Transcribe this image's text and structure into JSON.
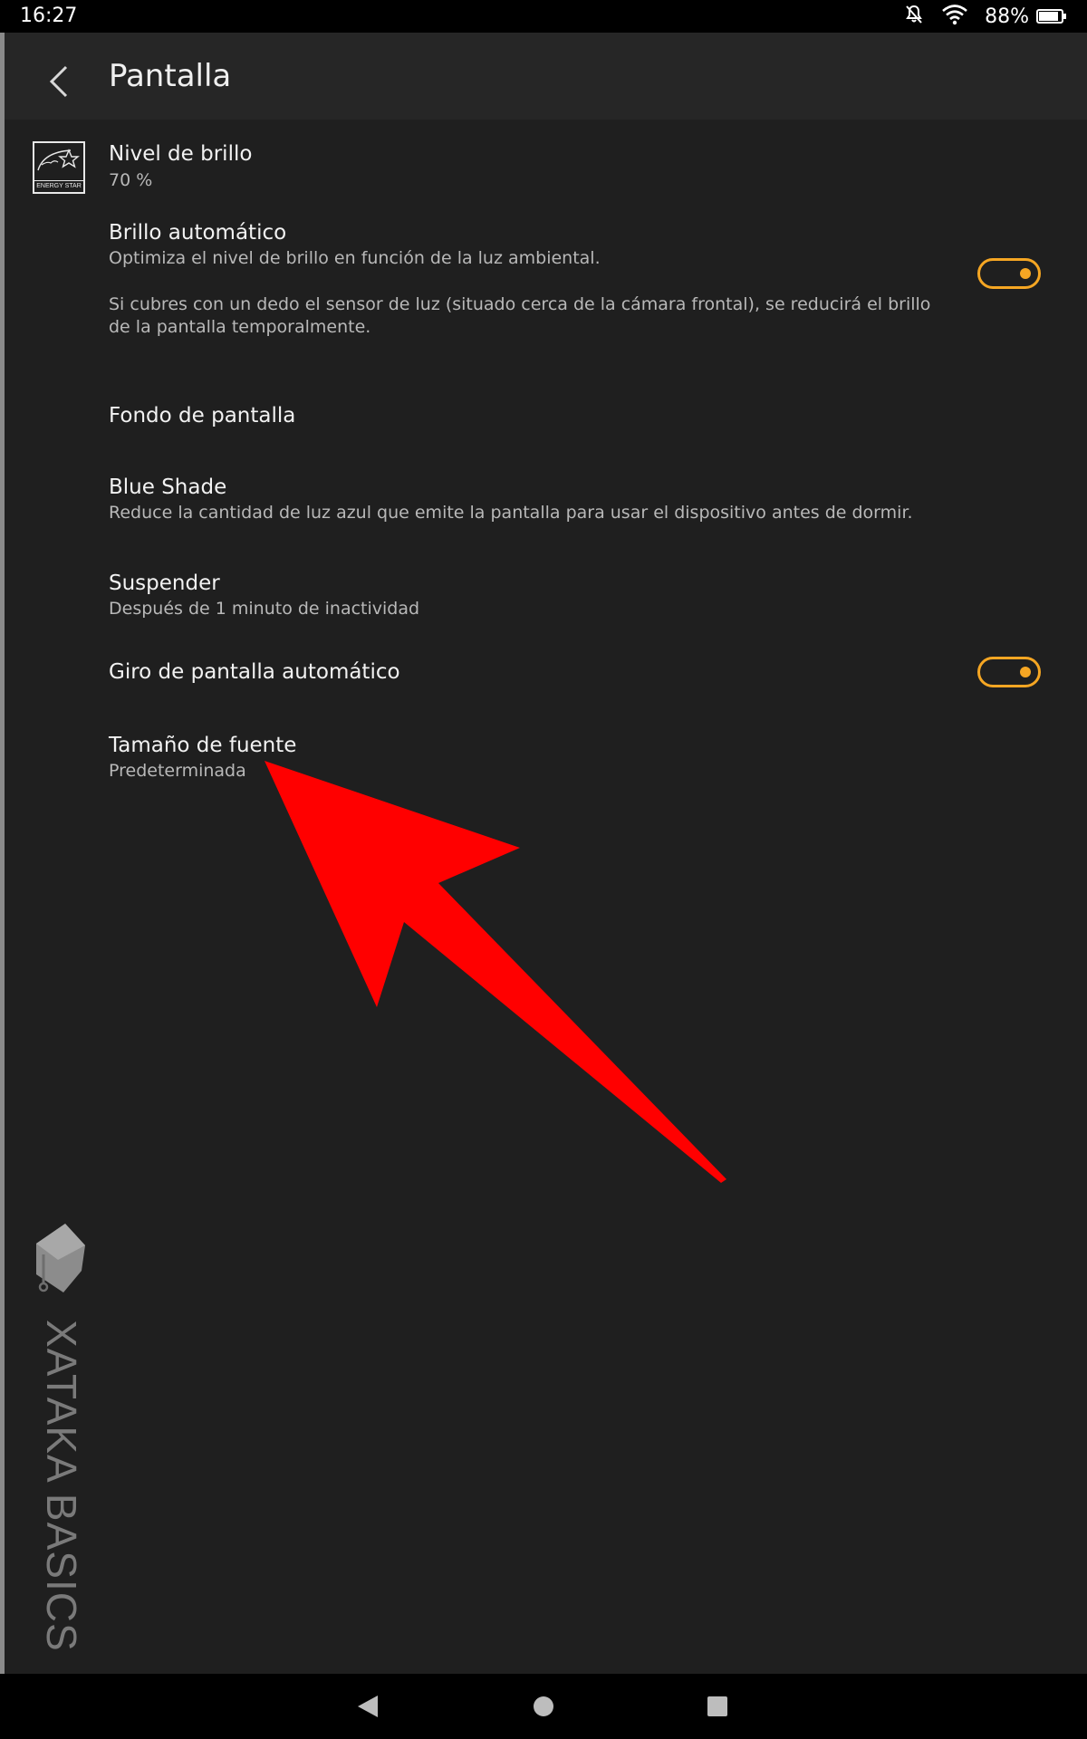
{
  "status_bar": {
    "time": "16:27",
    "battery_text": "88%",
    "battery_level": 0.88
  },
  "header": {
    "title": "Pantalla"
  },
  "settings": {
    "brightness": {
      "title": "Nivel de brillo",
      "value": "70 %"
    },
    "energy_star_label": "ENERGY STAR",
    "auto_brightness": {
      "title": "Brillo automático",
      "desc1": "Optimiza el nivel de brillo en función de la luz ambiental.",
      "desc2": "Si cubres con un dedo el sensor de luz (situado cerca de la cámara frontal), se reducirá el brillo de la pantalla temporalmente.",
      "enabled": true
    },
    "wallpaper": {
      "title": "Fondo de pantalla"
    },
    "blue_shade": {
      "title": "Blue Shade",
      "desc": "Reduce la cantidad de luz azul que emite la pantalla para usar el dispositivo antes de dormir."
    },
    "sleep": {
      "title": "Suspender",
      "desc": "Después de 1 minuto de inactividad"
    },
    "auto_rotate": {
      "title": "Giro de pantalla automático",
      "enabled": true
    },
    "font_size": {
      "title": "Tamaño de fuente",
      "value": "Predeterminada"
    }
  },
  "watermark": {
    "text": "XATAKA BASICS"
  },
  "colors": {
    "accent": "#f5a623",
    "background": "#1f1f1f",
    "header": "#262626",
    "annotation_arrow": "#ff0000"
  },
  "icons": {
    "back": "chevron-left-icon",
    "energy_star": "energy-star-icon",
    "dnd": "notifications-off-icon",
    "wifi": "wifi-icon",
    "battery": "battery-icon",
    "nav_back": "triangle-back-icon",
    "nav_home": "circle-home-icon",
    "nav_recents": "square-recents-icon"
  }
}
